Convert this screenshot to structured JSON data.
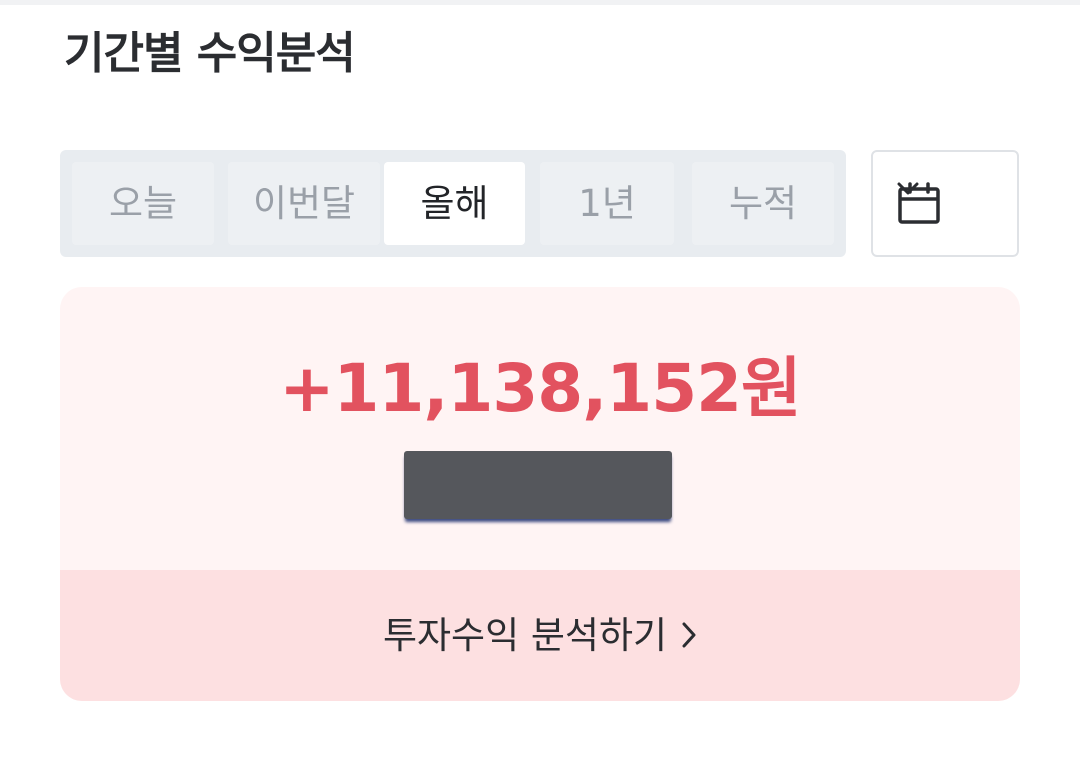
{
  "header": {
    "title": "기간별 수익분석"
  },
  "period_tabs": [
    {
      "label": "오늘",
      "selected": false
    },
    {
      "label": "이번달",
      "selected": false
    },
    {
      "label": "올해",
      "selected": true
    },
    {
      "label": "1년",
      "selected": false
    },
    {
      "label": "누적",
      "selected": false
    }
  ],
  "calendar_button": {
    "icon": "calendar-icon",
    "dropdown_icon": "chevron-down-icon"
  },
  "profit_summary": {
    "amount": "+11,138,152원",
    "secondary_value_redacted": true
  },
  "analysis_link": {
    "label": "투자수익 분석하기",
    "icon": "chevron-right-icon"
  },
  "colors": {
    "profit_red": "#e2525f",
    "card_background": "#fff4f4",
    "link_background": "#fde0e1",
    "tab_track": "#e8ecf0"
  }
}
